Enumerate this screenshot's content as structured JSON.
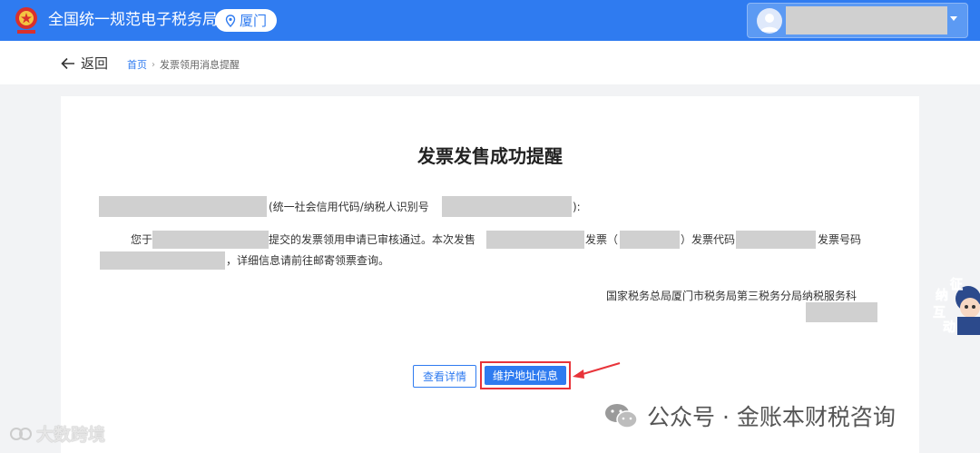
{
  "header": {
    "app_title": "全国统一规范电子税务局",
    "location": "厦门"
  },
  "nav": {
    "back_label": "返回",
    "breadcrumb_home": "首页",
    "breadcrumb_sep": "›",
    "breadcrumb_current": "发票领用消息提醒"
  },
  "notice": {
    "title": "发票发售成功提醒",
    "taxpayer_suffix": "(统一社会信用代码/纳税人识别号",
    "colon": "):",
    "line1_prefix": "您于",
    "line1_mid": "提交的发票领用申请已审核通过。本次发售",
    "invoice_label": "发票（",
    "code_label": "）发票代码",
    "number_label": "发票号码",
    "line2_suffix": "，详细信息请前往邮寄领票查询。",
    "signature": "国家税务总局厦门市税务局第三税务分局纳税服务科"
  },
  "buttons": {
    "view_detail": "查看详情",
    "maintain_address": "维护地址信息"
  },
  "widget": {
    "chars": [
      "征",
      "纳",
      "互",
      "动"
    ]
  },
  "watermarks": {
    "left": "大数跨境",
    "right": "公众号 · 金账本财税咨询"
  },
  "colors": {
    "primary": "#2f7bf0",
    "highlight": "#e8343a",
    "mask": "#d0d0d0"
  }
}
